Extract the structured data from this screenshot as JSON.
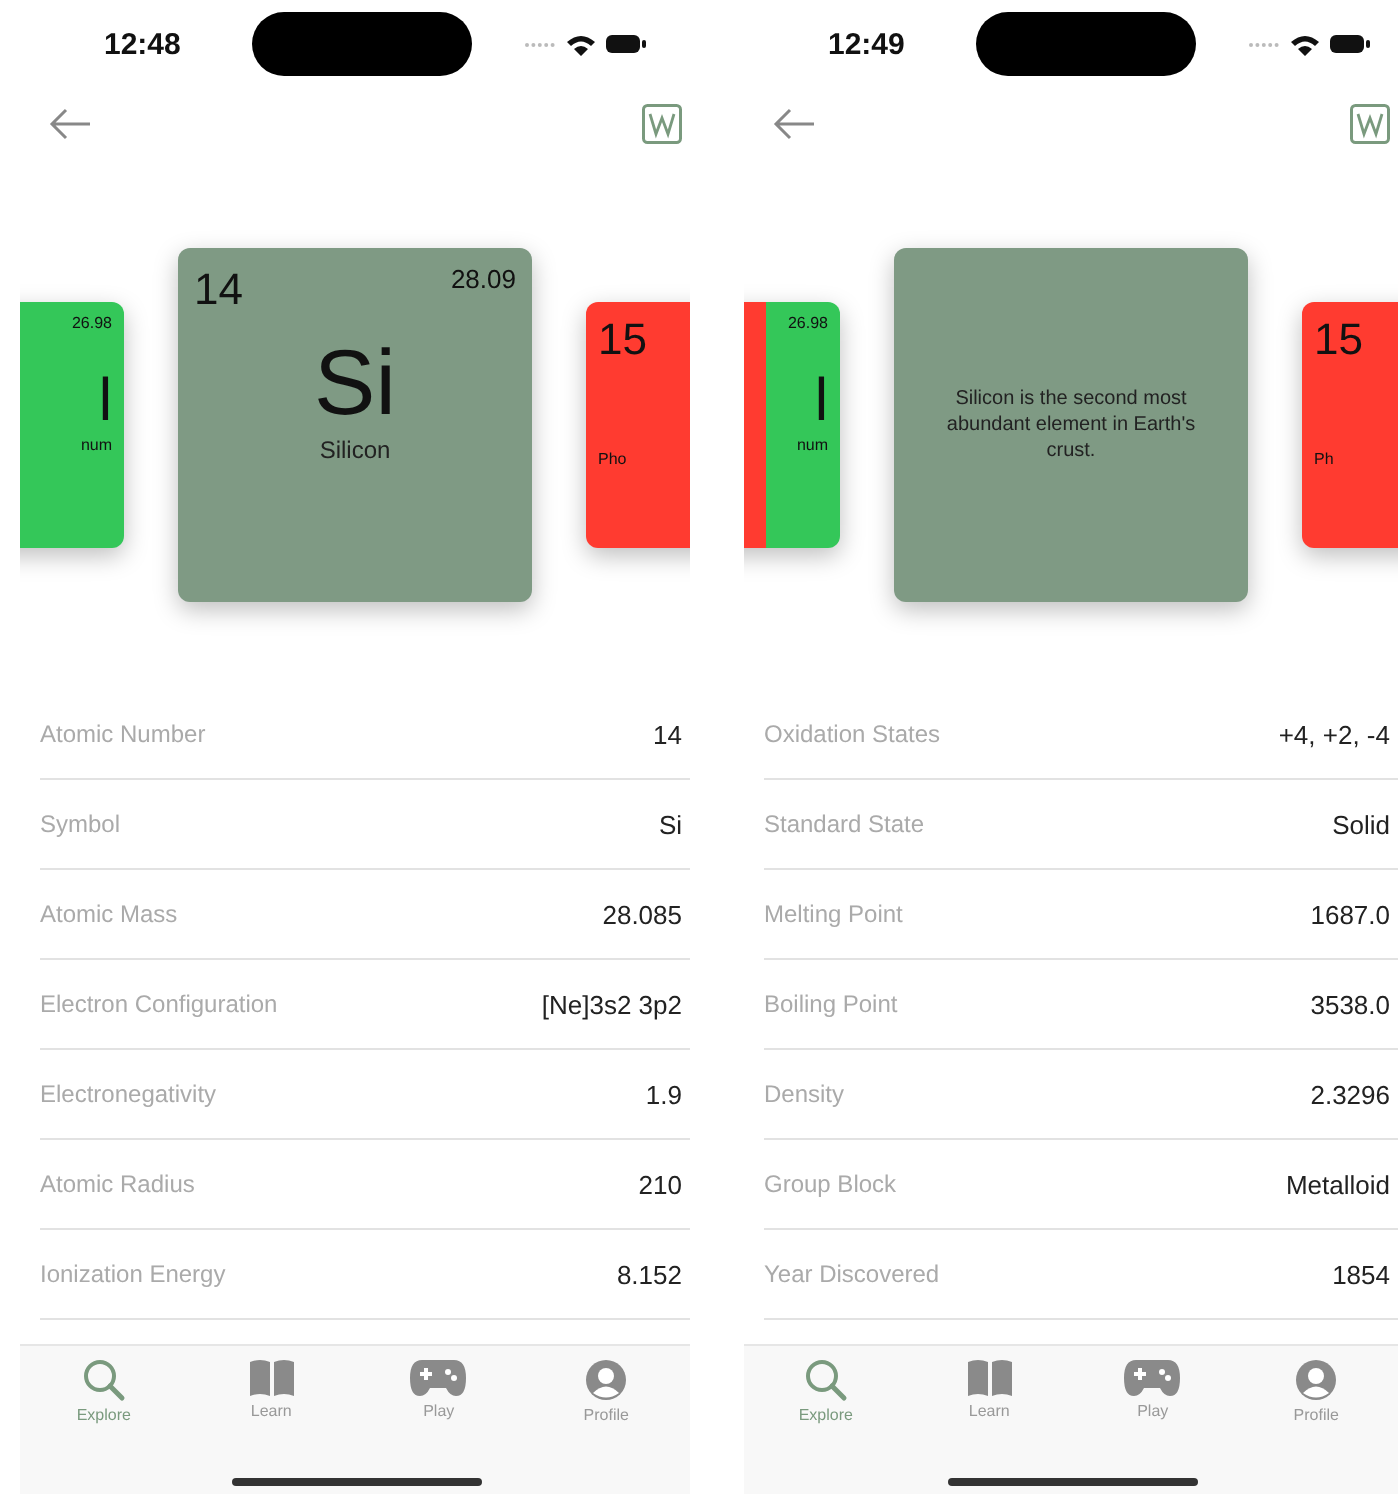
{
  "phones": [
    {
      "status_time": "12:48",
      "cards": {
        "left": {
          "color": "#34c759",
          "mass": "26.98",
          "symbol": "l",
          "name": "num"
        },
        "main": {
          "kind": "front",
          "number": "14",
          "mass": "28.09",
          "symbol": "Si",
          "name": "Silicon"
        },
        "right": {
          "color": "#ff3b30",
          "number": "15",
          "name": "Pho"
        }
      },
      "properties": [
        {
          "label": "Atomic Number",
          "value": "14"
        },
        {
          "label": "Symbol",
          "value": "Si"
        },
        {
          "label": "Atomic Mass",
          "value": "28.085"
        },
        {
          "label": "Electron Configuration",
          "value": "[Ne]3s2 3p2"
        },
        {
          "label": "Electronegativity",
          "value": "1.9"
        },
        {
          "label": "Atomic Radius",
          "value": "210"
        },
        {
          "label": "Ionization Energy",
          "value": "8.152"
        }
      ],
      "tabs": [
        {
          "label": "Explore",
          "selected": true
        },
        {
          "label": "Learn",
          "selected": false
        },
        {
          "label": "Play",
          "selected": false
        },
        {
          "label": "Profile",
          "selected": false
        }
      ]
    },
    {
      "status_time": "12:49",
      "cards": {
        "left": {
          "color": "#34c759",
          "overlay": {
            "color": "#ff3b30"
          },
          "mass": "26.98",
          "symbol": "l",
          "name": "num"
        },
        "main": {
          "kind": "fact",
          "text": "Silicon is the second most abundant element in Earth's crust."
        },
        "right": {
          "color": "#ff3b30",
          "number": "15",
          "name": "Ph"
        }
      },
      "properties": [
        {
          "label": "Oxidation States",
          "value": "+4, +2, -4"
        },
        {
          "label": "Standard State",
          "value": "Solid"
        },
        {
          "label": "Melting Point",
          "value": "1687.0"
        },
        {
          "label": "Boiling Point",
          "value": "3538.0"
        },
        {
          "label": "Density",
          "value": "2.3296"
        },
        {
          "label": "Group Block",
          "value": "Metalloid"
        },
        {
          "label": "Year Discovered",
          "value": "1854"
        }
      ],
      "tabs": [
        {
          "label": "Explore",
          "selected": true
        },
        {
          "label": "Learn",
          "selected": false
        },
        {
          "label": "Play",
          "selected": false
        },
        {
          "label": "Profile",
          "selected": false
        }
      ]
    }
  ]
}
